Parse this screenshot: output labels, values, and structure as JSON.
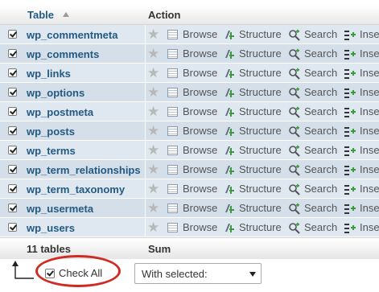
{
  "header": {
    "table_label": "Table",
    "action_label": "Action"
  },
  "actions": {
    "browse": "Browse",
    "structure": "Structure",
    "search": "Search",
    "insert": "Inse"
  },
  "tables": [
    {
      "name": "wp_commentmeta"
    },
    {
      "name": "wp_comments"
    },
    {
      "name": "wp_links"
    },
    {
      "name": "wp_options"
    },
    {
      "name": "wp_postmeta"
    },
    {
      "name": "wp_posts"
    },
    {
      "name": "wp_terms"
    },
    {
      "name": "wp_term_relationships"
    },
    {
      "name": "wp_term_taxonomy"
    },
    {
      "name": "wp_usermeta"
    },
    {
      "name": "wp_users"
    }
  ],
  "footer": {
    "count_label": "11 tables",
    "sum_label": "Sum"
  },
  "bulk": {
    "check_all_label": "Check All",
    "with_selected_label": "With selected:"
  },
  "colors": {
    "link": "#235a81",
    "row": "#dfe7f0",
    "row_alt": "#d5dfea",
    "highlight_ring": "#d02b22"
  }
}
